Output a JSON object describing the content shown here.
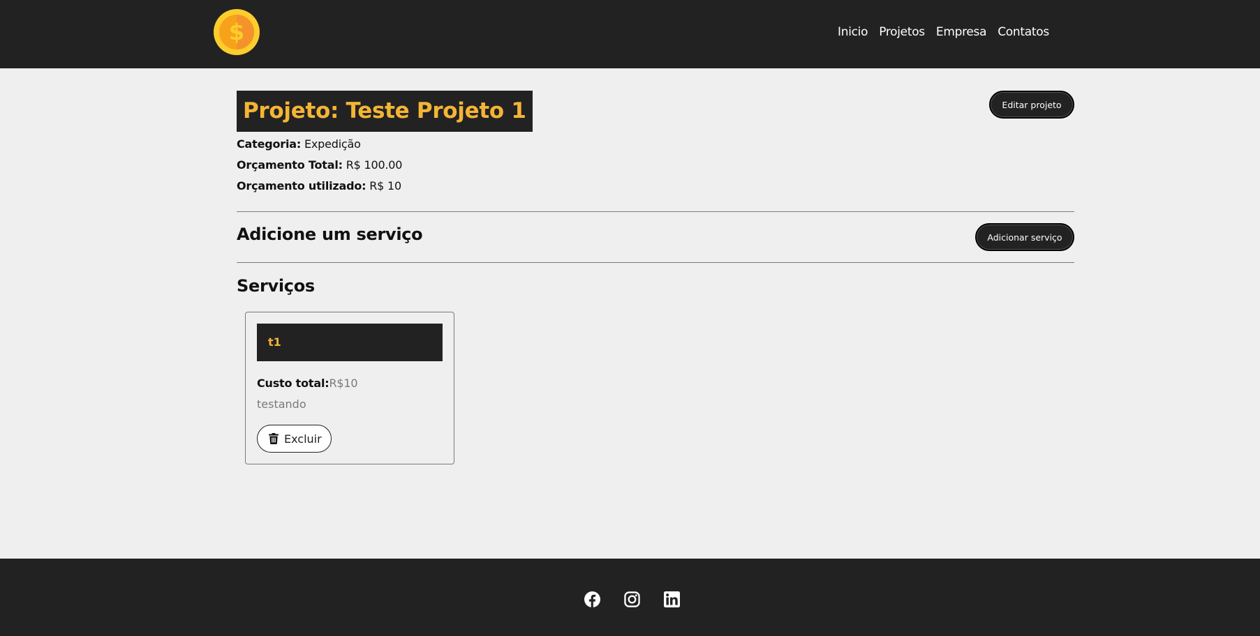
{
  "nav": {
    "logo_icon": "coin-dollar-icon",
    "links": [
      "Inicio",
      "Projetos",
      "Empresa",
      "Contatos"
    ]
  },
  "project": {
    "title": "Projeto: Teste Projeto 1",
    "edit_button": "Editar projeto",
    "category_label": "Categoria:",
    "category_value": "Expedição",
    "budget_total_label": "Orçamento Total:",
    "budget_total_value": "R$ 100.00",
    "budget_used_label": "Orçamento utilizado:",
    "budget_used_value": "R$ 10"
  },
  "add_service": {
    "heading": "Adicione um serviço",
    "button": "Adicionar serviço"
  },
  "services": {
    "heading": "Serviços",
    "items": [
      {
        "name": "t1",
        "cost_label": "Custo total:",
        "cost_value": "R$10",
        "description": "testando",
        "delete_label": "Excluir",
        "delete_icon": "trash-icon"
      }
    ]
  },
  "footer": {
    "social_icons": [
      "facebook-icon",
      "instagram-icon",
      "linkedin-icon"
    ]
  },
  "colors": {
    "dark": "#222222",
    "accent": "#f4b535",
    "background": "#efefef",
    "muted": "#7a7a7a"
  }
}
